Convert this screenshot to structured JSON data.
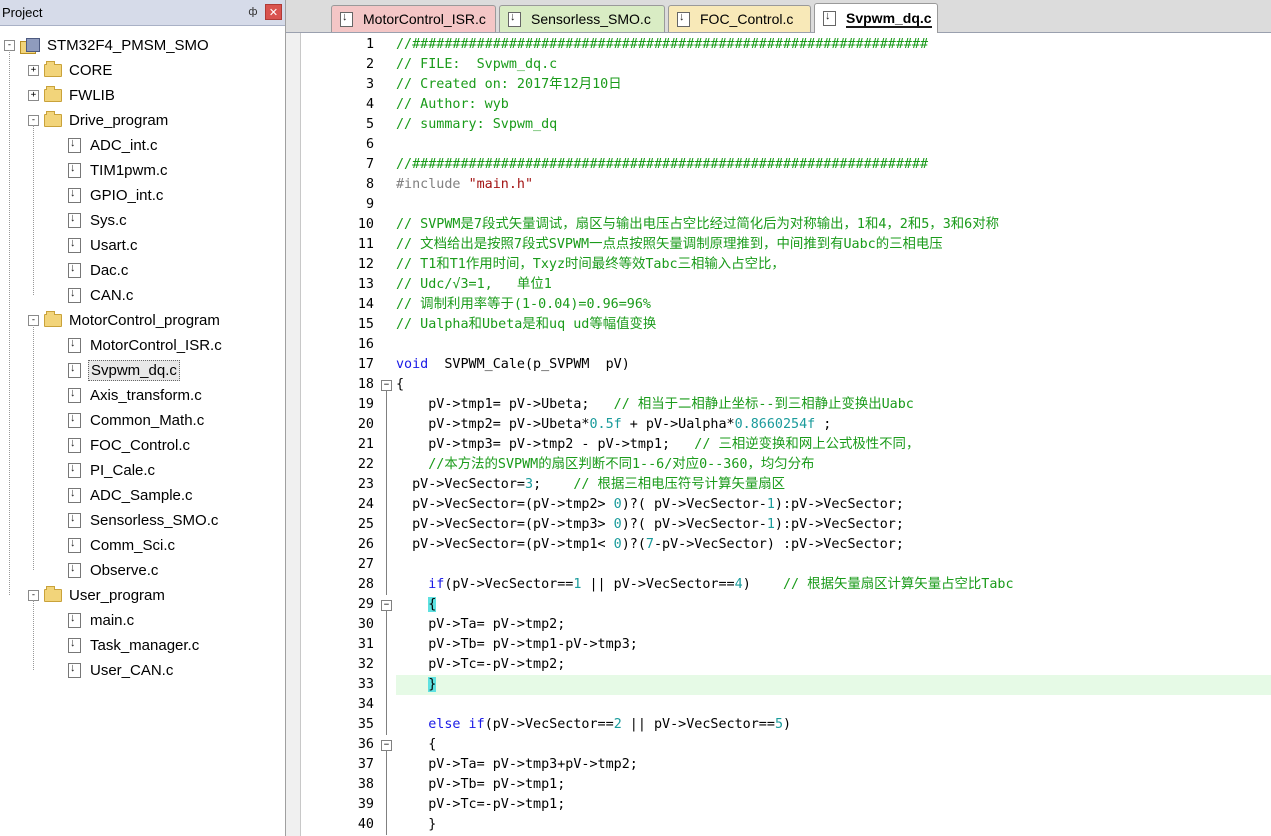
{
  "project_panel": {
    "title": "Project",
    "pin_glyph": "ф",
    "close_glyph": "✕",
    "tree": [
      {
        "label": "STM32F4_PMSM_SMO",
        "kind": "project",
        "depth": 0,
        "expander": "-"
      },
      {
        "label": "CORE",
        "kind": "folder",
        "depth": 1,
        "expander": "+"
      },
      {
        "label": "FWLIB",
        "kind": "folder",
        "depth": 1,
        "expander": "+"
      },
      {
        "label": "Drive_program",
        "kind": "folder-open",
        "depth": 1,
        "expander": "-"
      },
      {
        "label": "ADC_int.c",
        "kind": "file",
        "depth": 2
      },
      {
        "label": "TIM1pwm.c",
        "kind": "file",
        "depth": 2
      },
      {
        "label": "GPIO_int.c",
        "kind": "file",
        "depth": 2
      },
      {
        "label": "Sys.c",
        "kind": "file",
        "depth": 2
      },
      {
        "label": "Usart.c",
        "kind": "file",
        "depth": 2
      },
      {
        "label": "Dac.c",
        "kind": "file",
        "depth": 2
      },
      {
        "label": "CAN.c",
        "kind": "file",
        "depth": 2
      },
      {
        "label": "MotorControl_program",
        "kind": "folder-open",
        "depth": 1,
        "expander": "-"
      },
      {
        "label": "MotorControl_ISR.c",
        "kind": "file",
        "depth": 2
      },
      {
        "label": "Svpwm_dq.c",
        "kind": "file",
        "depth": 2,
        "selected": true
      },
      {
        "label": "Axis_transform.c",
        "kind": "file",
        "depth": 2
      },
      {
        "label": "Common_Math.c",
        "kind": "file",
        "depth": 2
      },
      {
        "label": "FOC_Control.c",
        "kind": "file",
        "depth": 2
      },
      {
        "label": "PI_Cale.c",
        "kind": "file",
        "depth": 2
      },
      {
        "label": "ADC_Sample.c",
        "kind": "file",
        "depth": 2
      },
      {
        "label": "Sensorless_SMO.c",
        "kind": "file",
        "depth": 2
      },
      {
        "label": "Comm_Sci.c",
        "kind": "file",
        "depth": 2
      },
      {
        "label": "Observe.c",
        "kind": "file",
        "depth": 2
      },
      {
        "label": "User_program",
        "kind": "folder-open",
        "depth": 1,
        "expander": "-"
      },
      {
        "label": "main.c",
        "kind": "file",
        "depth": 2
      },
      {
        "label": "Task_manager.c",
        "kind": "file",
        "depth": 2
      },
      {
        "label": "User_CAN.c",
        "kind": "file",
        "depth": 2
      }
    ]
  },
  "tabs": [
    {
      "label": "MotorControl_ISR.c",
      "color": "#f4c6c6",
      "active": false
    },
    {
      "label": "Sensorless_SMO.c",
      "color": "#d9ecc4",
      "active": false
    },
    {
      "label": "FOC_Control.c",
      "color": "#f8e9b8",
      "active": false
    },
    {
      "label": "Svpwm_dq.c",
      "color": "#ffffff",
      "active": true
    }
  ],
  "editor": {
    "current_line": 33,
    "lines": [
      {
        "n": "1",
        "fold": "",
        "segs": [
          [
            "comment",
            "//################################################################"
          ]
        ]
      },
      {
        "n": "2",
        "fold": "",
        "segs": [
          [
            "comment",
            "// FILE:  Svpwm_dq.c"
          ]
        ]
      },
      {
        "n": "3",
        "fold": "",
        "segs": [
          [
            "comment",
            "// Created on: 2017年12月10日"
          ]
        ]
      },
      {
        "n": "4",
        "fold": "",
        "segs": [
          [
            "comment",
            "// Author: wyb"
          ]
        ]
      },
      {
        "n": "5",
        "fold": "",
        "segs": [
          [
            "comment",
            "// summary: Svpwm_dq"
          ]
        ]
      },
      {
        "n": "6",
        "fold": "",
        "segs": []
      },
      {
        "n": "7",
        "fold": "",
        "segs": [
          [
            "comment",
            "//################################################################"
          ]
        ]
      },
      {
        "n": "8",
        "fold": "",
        "segs": [
          [
            "pp",
            "#include "
          ],
          [
            "str",
            "\"main.h\""
          ]
        ]
      },
      {
        "n": "9",
        "fold": "",
        "segs": []
      },
      {
        "n": "10",
        "fold": "",
        "segs": [
          [
            "comment",
            "// SVPWM是7段式矢量调试，扇区与输出电压占空比经过简化后为对称输出，1和4，2和5，3和6对称"
          ]
        ]
      },
      {
        "n": "11",
        "fold": "",
        "segs": [
          [
            "comment",
            "// 文档给出是按照7段式SVPWM一点点按照矢量调制原理推到，中间推到有Uabc的三相电压"
          ]
        ]
      },
      {
        "n": "12",
        "fold": "",
        "segs": [
          [
            "comment",
            "// T1和T1作用时间，Txyz时间最终等效Tabc三相输入占空比，"
          ]
        ]
      },
      {
        "n": "13",
        "fold": "",
        "segs": [
          [
            "comment",
            "// Udc/√3=1,   单位1"
          ]
        ]
      },
      {
        "n": "14",
        "fold": "",
        "segs": [
          [
            "comment",
            "// 调制利用率等于(1-0.04)=0.96=96%"
          ]
        ]
      },
      {
        "n": "15",
        "fold": "",
        "segs": [
          [
            "comment",
            "// Ualpha和Ubeta是和uq ud等幅值变换"
          ]
        ]
      },
      {
        "n": "16",
        "fold": "",
        "segs": []
      },
      {
        "n": "17",
        "fold": "",
        "segs": [
          [
            "kw",
            "void"
          ],
          [
            "plain",
            "  SVPWM_Cale(p_SVPWM  pV)"
          ]
        ]
      },
      {
        "n": "18",
        "fold": "-",
        "segs": [
          [
            "plain",
            "{"
          ]
        ]
      },
      {
        "n": "19",
        "fold": "|",
        "segs": [
          [
            "plain",
            "    pV->tmp1= pV->Ubeta;   "
          ],
          [
            "comment",
            "// 相当于二相静止坐标--到三相静止变换出Uabc"
          ]
        ]
      },
      {
        "n": "20",
        "fold": "|",
        "segs": [
          [
            "plain",
            "    pV->tmp2= pV->Ubeta*"
          ],
          [
            "num",
            "0.5f"
          ],
          [
            "plain",
            " + pV->Ualpha*"
          ],
          [
            "num",
            "0.8660254f"
          ],
          [
            "plain",
            " ;"
          ]
        ]
      },
      {
        "n": "21",
        "fold": "|",
        "segs": [
          [
            "plain",
            "    pV->tmp3= pV->tmp2 - pV->tmp1;   "
          ],
          [
            "comment",
            "// 三相逆变换和网上公式极性不同，"
          ]
        ]
      },
      {
        "n": "22",
        "fold": "|",
        "segs": [
          [
            "comment",
            "    //本方法的SVPWM的扇区判断不同1--6/对应0--360，均匀分布"
          ]
        ]
      },
      {
        "n": "23",
        "fold": "|",
        "segs": [
          [
            "plain",
            "  pV->VecSector="
          ],
          [
            "num",
            "3"
          ],
          [
            "plain",
            ";    "
          ],
          [
            "comment",
            "// 根据三相电压符号计算矢量扇区"
          ]
        ]
      },
      {
        "n": "24",
        "fold": "|",
        "segs": [
          [
            "plain",
            "  pV->VecSector=(pV->tmp2> "
          ],
          [
            "num",
            "0"
          ],
          [
            "plain",
            ")?( pV->VecSector-"
          ],
          [
            "num",
            "1"
          ],
          [
            "plain",
            "):pV->VecSector;"
          ]
        ]
      },
      {
        "n": "25",
        "fold": "|",
        "segs": [
          [
            "plain",
            "  pV->VecSector=(pV->tmp3> "
          ],
          [
            "num",
            "0"
          ],
          [
            "plain",
            ")?( pV->VecSector-"
          ],
          [
            "num",
            "1"
          ],
          [
            "plain",
            "):pV->VecSector;"
          ]
        ]
      },
      {
        "n": "26",
        "fold": "|",
        "segs": [
          [
            "plain",
            "  pV->VecSector=(pV->tmp1< "
          ],
          [
            "num",
            "0"
          ],
          [
            "plain",
            ")?("
          ],
          [
            "num",
            "7"
          ],
          [
            "plain",
            "-pV->VecSector) :pV->VecSector;"
          ]
        ]
      },
      {
        "n": "27",
        "fold": "|",
        "segs": []
      },
      {
        "n": "28",
        "fold": "|",
        "segs": [
          [
            "plain",
            "    "
          ],
          [
            "kw",
            "if"
          ],
          [
            "plain",
            "(pV->VecSector=="
          ],
          [
            "num",
            "1"
          ],
          [
            "plain",
            " || pV->VecSector=="
          ],
          [
            "num",
            "4"
          ],
          [
            "plain",
            ")    "
          ],
          [
            "comment",
            "// 根据矢量扇区计算矢量占空比Tabc"
          ]
        ]
      },
      {
        "n": "29",
        "fold": "-",
        "segs": [
          [
            "plain",
            "    "
          ],
          [
            "brace",
            "{"
          ]
        ]
      },
      {
        "n": "30",
        "fold": "|",
        "segs": [
          [
            "plain",
            "    pV->Ta= pV->tmp2;"
          ]
        ]
      },
      {
        "n": "31",
        "fold": "|",
        "segs": [
          [
            "plain",
            "    pV->Tb= pV->tmp1-pV->tmp3;"
          ]
        ]
      },
      {
        "n": "32",
        "fold": "|",
        "segs": [
          [
            "plain",
            "    pV->Tc=-pV->tmp2;"
          ]
        ]
      },
      {
        "n": "33",
        "fold": "|",
        "segs": [
          [
            "plain",
            "    "
          ],
          [
            "brace",
            "}"
          ]
        ]
      },
      {
        "n": "34",
        "fold": "|",
        "segs": []
      },
      {
        "n": "35",
        "fold": "|",
        "segs": [
          [
            "plain",
            "    "
          ],
          [
            "kw",
            "else if"
          ],
          [
            "plain",
            "(pV->VecSector=="
          ],
          [
            "num",
            "2"
          ],
          [
            "plain",
            " || pV->VecSector=="
          ],
          [
            "num",
            "5"
          ],
          [
            "plain",
            ")"
          ]
        ]
      },
      {
        "n": "36",
        "fold": "-",
        "segs": [
          [
            "plain",
            "    {"
          ]
        ]
      },
      {
        "n": "37",
        "fold": "|",
        "segs": [
          [
            "plain",
            "    pV->Ta= pV->tmp3+pV->tmp2;"
          ]
        ]
      },
      {
        "n": "38",
        "fold": "|",
        "segs": [
          [
            "plain",
            "    pV->Tb= pV->tmp1;"
          ]
        ]
      },
      {
        "n": "39",
        "fold": "|",
        "segs": [
          [
            "plain",
            "    pV->Tc=-pV->tmp1;"
          ]
        ]
      },
      {
        "n": "40",
        "fold": "|",
        "segs": [
          [
            "plain",
            "    }"
          ]
        ]
      }
    ]
  }
}
